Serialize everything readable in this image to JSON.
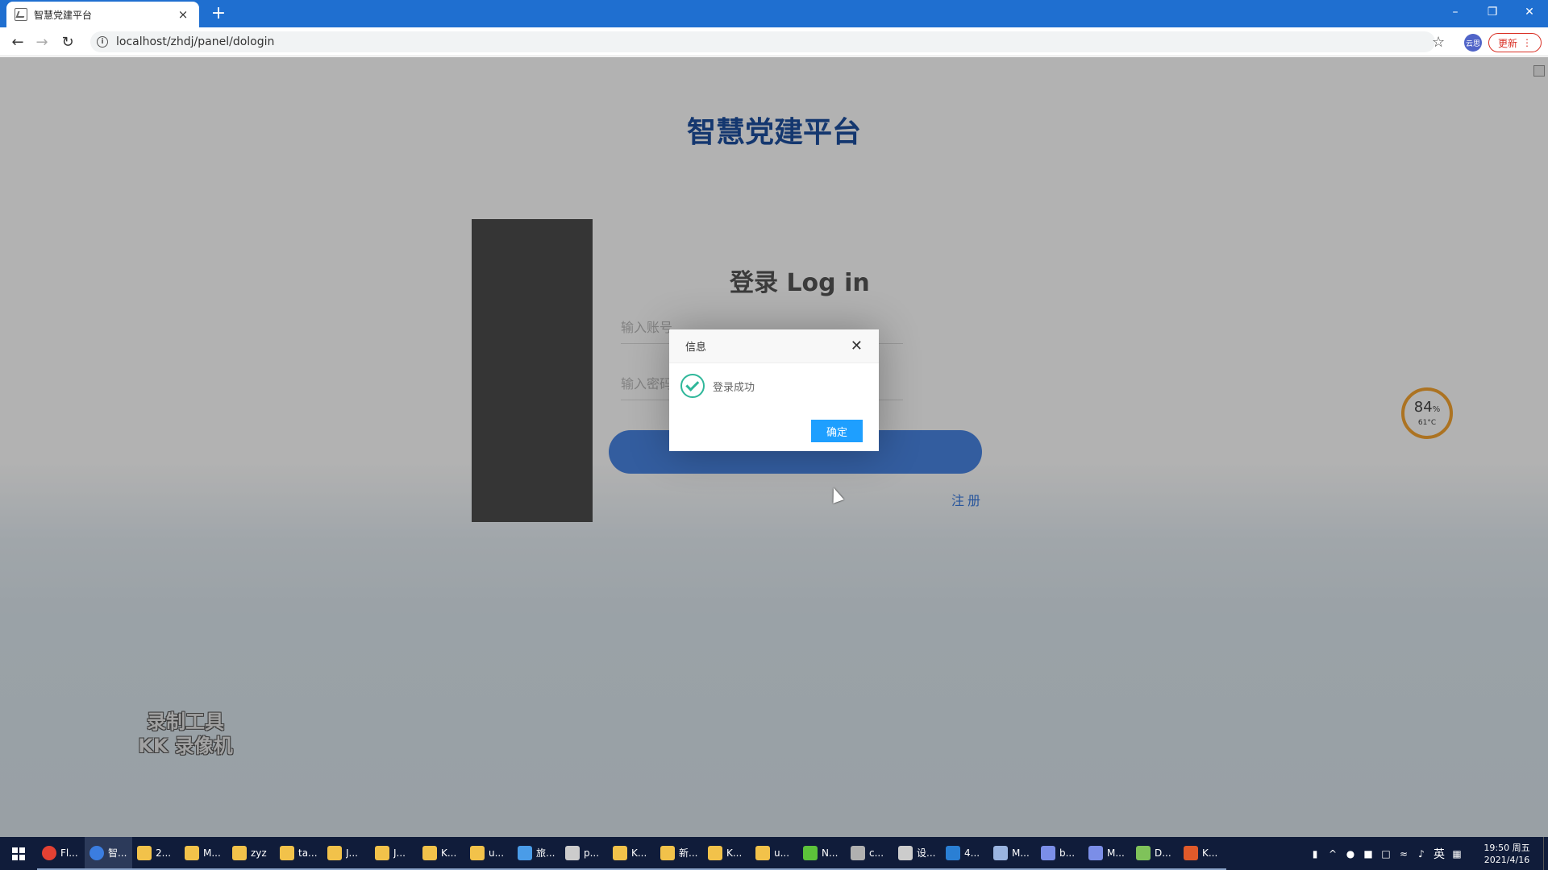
{
  "browser": {
    "tab_title": "智慧党建平台",
    "tab_close": "×",
    "new_tab": "+",
    "url": "localhost/zhdj/panel/dologin",
    "update_label": "更新",
    "ext_label": "云思",
    "win_minimize": "–",
    "win_restore": "❐",
    "win_close": "✕"
  },
  "page": {
    "platform_title": "智慧党建平台",
    "login_heading": "登录 Log in",
    "account_placeholder": "输入账号...",
    "password_placeholder": "输入密码...",
    "register_label": "注册"
  },
  "dialog": {
    "title": "信息",
    "close": "✕",
    "message": "登录成功",
    "ok_label": "确定"
  },
  "cpu_gauge": {
    "value": "84",
    "unit": "%",
    "temperature": "61°C"
  },
  "watermark": {
    "line1": "录制工具",
    "line2": "KK 录像机"
  },
  "taskbar": {
    "items": [
      {
        "label": "Fl...",
        "icon": "chrome-icon",
        "color": "#e34133"
      },
      {
        "label": "智...",
        "icon": "chrome-icon",
        "color": "#3b7de0"
      },
      {
        "label": "2...",
        "icon": "folder-icon",
        "color": "#f2c24a"
      },
      {
        "label": "M...",
        "icon": "folder-icon",
        "color": "#f2c24a"
      },
      {
        "label": "zyz",
        "icon": "folder-icon",
        "color": "#f2c24a"
      },
      {
        "label": "ta...",
        "icon": "folder-icon",
        "color": "#f2c24a"
      },
      {
        "label": "J...",
        "icon": "folder-icon",
        "color": "#f2c24a"
      },
      {
        "label": "J...",
        "icon": "folder-icon",
        "color": "#f2c24a"
      },
      {
        "label": "K...",
        "icon": "folder-icon",
        "color": "#f2c24a"
      },
      {
        "label": "u...",
        "icon": "folder-icon",
        "color": "#f2c24a"
      },
      {
        "label": "旅...",
        "icon": "cube-icon",
        "color": "#4a9ce8"
      },
      {
        "label": "p...",
        "icon": "plane-icon",
        "color": "#cccccc"
      },
      {
        "label": "K...",
        "icon": "folder-icon",
        "color": "#f2c24a"
      },
      {
        "label": "新...",
        "icon": "folder-icon",
        "color": "#f2c24a"
      },
      {
        "label": "K...",
        "icon": "folder-icon",
        "color": "#f2c24a"
      },
      {
        "label": "u...",
        "icon": "folder-icon",
        "color": "#f2c24a"
      },
      {
        "label": "N...",
        "icon": "leaf-icon",
        "color": "#5cc23a"
      },
      {
        "label": "c...",
        "icon": "archive-icon",
        "color": "#b0b0b0"
      },
      {
        "label": "设...",
        "icon": "gear-icon",
        "color": "#cccccc"
      },
      {
        "label": "4...",
        "icon": "vscode-icon",
        "color": "#2a7fd4"
      },
      {
        "label": "M...",
        "icon": "pen-icon",
        "color": "#9ab4e0"
      },
      {
        "label": "b...",
        "icon": "app-icon",
        "color": "#7b8ee8"
      },
      {
        "label": "M...",
        "icon": "app-icon",
        "color": "#7b8ee8"
      },
      {
        "label": "D...",
        "icon": "notepad-icon",
        "color": "#7fc25a"
      },
      {
        "label": "K...",
        "icon": "recorder-icon",
        "color": "#e05a2a"
      }
    ],
    "tray_ime": "英",
    "clock_time": "19:50 周五",
    "clock_date": "2021/4/16"
  }
}
